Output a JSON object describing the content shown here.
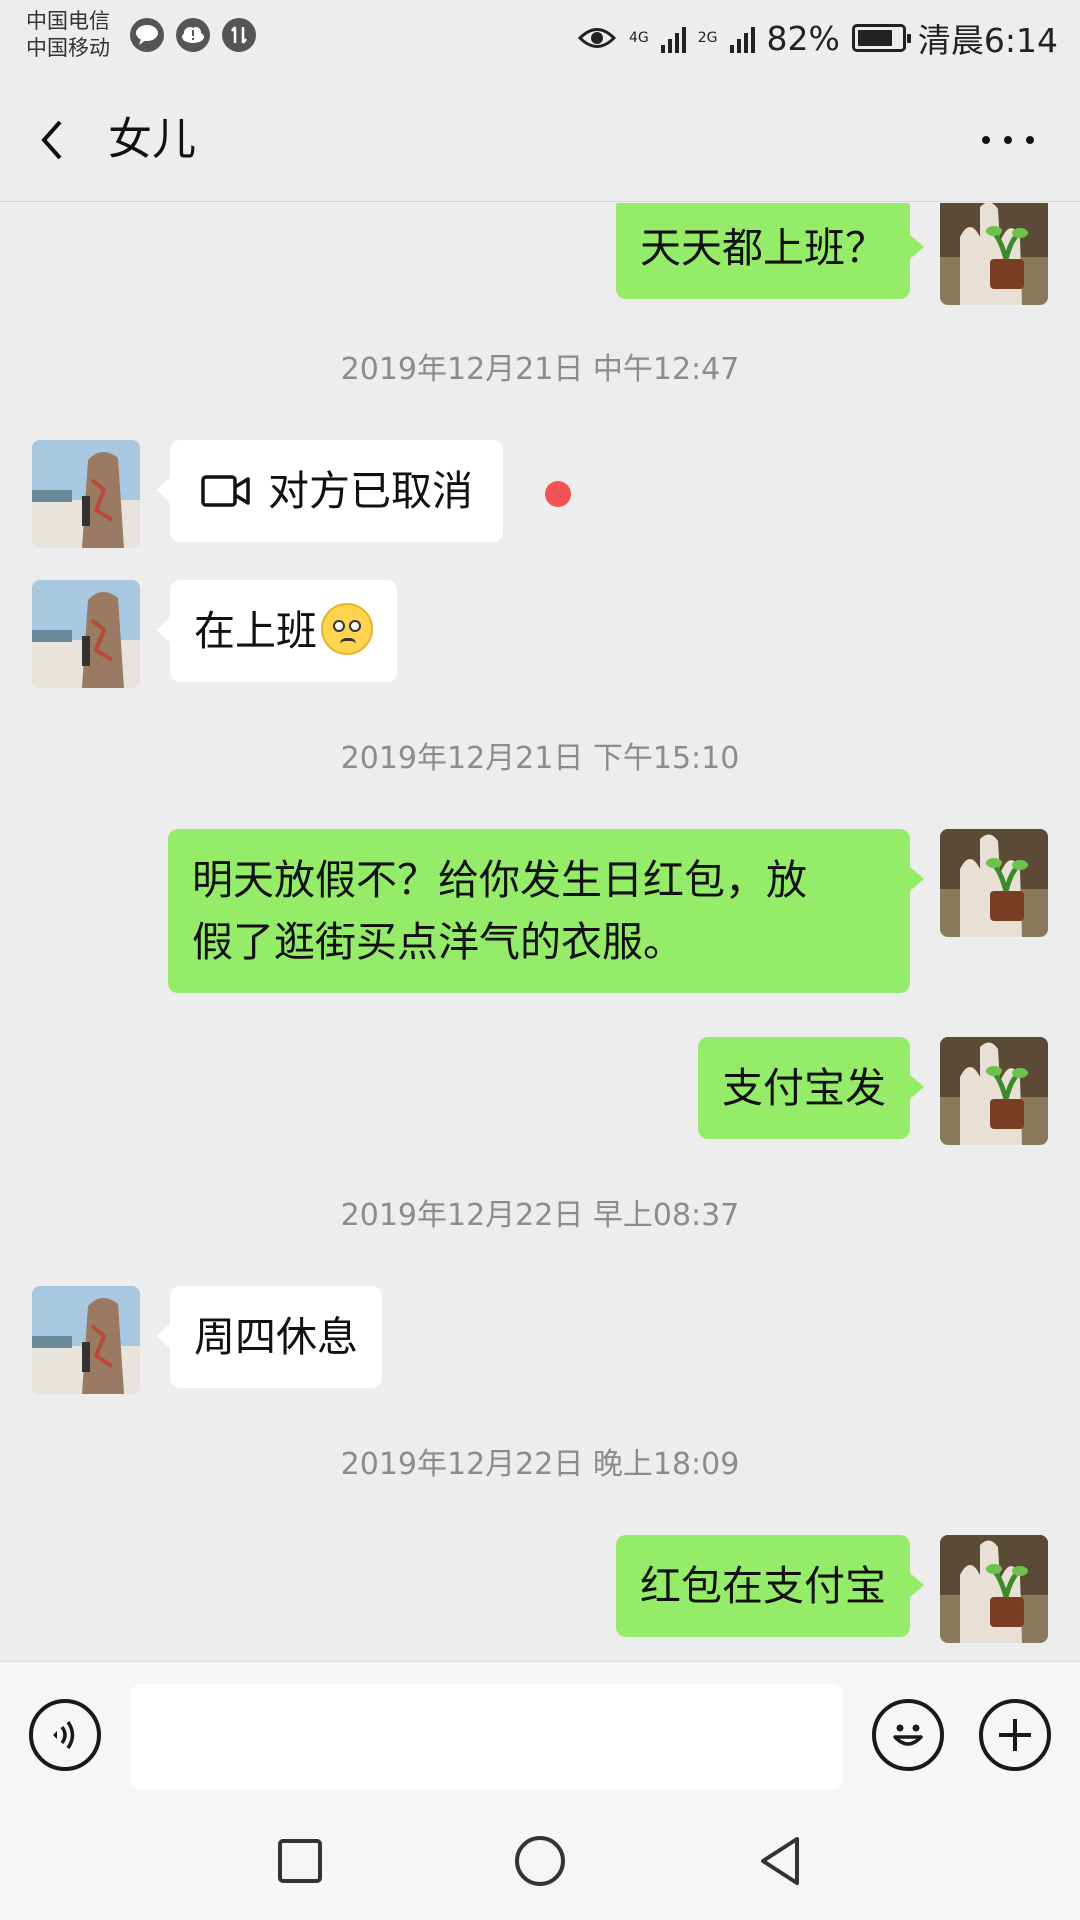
{
  "status_bar": {
    "carrier1": "中国电信",
    "carrier2": "中国移动",
    "net1": "4G",
    "net2": "2G",
    "battery": "82%",
    "battery_level": 0.82,
    "time": "清晨6:14"
  },
  "header": {
    "title": "女儿"
  },
  "messages": [
    {
      "type": "out",
      "text": "天天都上班？"
    },
    {
      "type": "time",
      "text": "2019年12月21日 中午12:47"
    },
    {
      "type": "in",
      "text": "对方已取消",
      "icon": "video-call-icon",
      "unread": true
    },
    {
      "type": "in",
      "text": "在上班",
      "emoji": "pleading-face-emoji"
    },
    {
      "type": "time",
      "text": "2019年12月21日 下午15:10"
    },
    {
      "type": "out",
      "line1": "明天放假不？给你发生日红包，放",
      "line2": "假了逛街买点洋气的衣服。"
    },
    {
      "type": "out",
      "text": "支付宝发"
    },
    {
      "type": "time",
      "text": "2019年12月22日 早上08:37"
    },
    {
      "type": "in",
      "text": "周四休息"
    },
    {
      "type": "time",
      "text": "2019年12月22日 晚上18:09"
    },
    {
      "type": "out",
      "text": "红包在支付宝"
    }
  ],
  "input_bar": {
    "value": "",
    "icons": [
      "voice-icon",
      "emoji-icon",
      "plus-icon"
    ]
  },
  "nav_bar": {
    "icons": [
      "recents-icon",
      "home-icon",
      "back-icon"
    ]
  },
  "colors": {
    "background": "#ededed",
    "outgoing_bubble": "#95ec69",
    "incoming_bubble": "#ffffff",
    "unread_dot": "#f25353",
    "timestamp_text": "#8c8c8c"
  }
}
